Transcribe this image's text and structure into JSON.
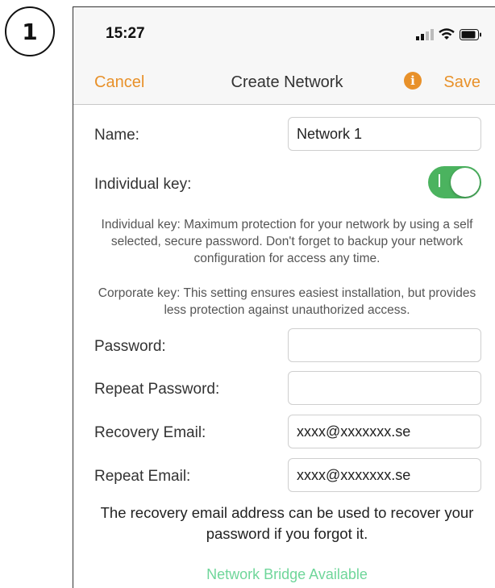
{
  "step": "1",
  "status": {
    "time": "15:27"
  },
  "nav": {
    "cancel": "Cancel",
    "title": "Create Network",
    "save": "Save"
  },
  "form": {
    "name_label": "Name:",
    "name_value": "Network 1",
    "individual_key_label": "Individual key:",
    "individual_key_on": true,
    "individual_help": "Individual key: Maximum protection for your network by using a self selected, secure password. Don't forget to backup your network configuration for access any time.",
    "corporate_help": "Corporate key: This setting ensures easiest installation, but provides less protection against unauthorized access.",
    "password_label": "Password:",
    "password_value": "",
    "repeat_password_label": "Repeat Password:",
    "repeat_password_value": "",
    "recovery_email_label": "Recovery Email:",
    "recovery_email_value": "xxxx@xxxxxxx.se",
    "repeat_email_label": "Repeat Email:",
    "repeat_email_value": "xxxx@xxxxxxx.se",
    "recovery_help": "The recovery email address can be used to recover your password if you forgot it."
  },
  "footer": {
    "bridge": "Network Bridge Available"
  },
  "colors": {
    "accent": "#e8912a",
    "toggle_on": "#4bb35f",
    "bridge": "#6fd69a"
  }
}
